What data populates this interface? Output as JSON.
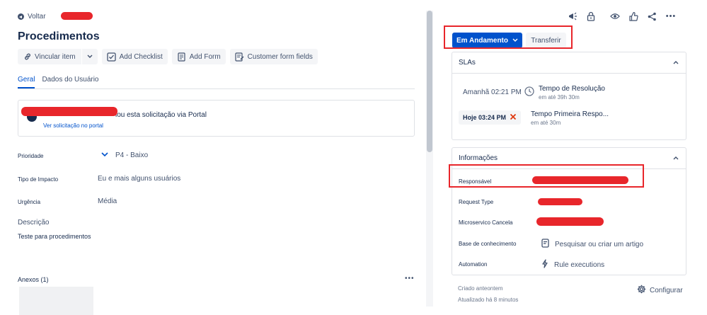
{
  "header": {
    "back_label": "Voltar",
    "title": "Procedimentos"
  },
  "toolbar": {
    "link_issue_label": "Vincular item",
    "add_checklist_label": "Add Checklist",
    "add_form_label": "Add Form",
    "customer_form_fields_label": "Customer form fields"
  },
  "tabs": [
    {
      "label": "Geral",
      "active": true
    },
    {
      "label": "Dados do Usuário",
      "active": false
    }
  ],
  "activity": {
    "message": "iou esta solicitação via Portal",
    "link": "Ver solicitação no portal"
  },
  "fields": {
    "priority_label": "Prioridade",
    "priority_value": "P4 - Baixo",
    "impact_label": "Tipo de Impacto",
    "impact_value": "Eu e mais alguns usuários",
    "urgency_label": "Urgência",
    "urgency_value": "Média",
    "description_label": "Descrição",
    "description_value": "Teste para procedimentos",
    "attachments_label": "Anexos (1)"
  },
  "actions": {
    "status_label": "Em Andamento",
    "transfer_label": "Transferir"
  },
  "slas": {
    "heading": "SLAs",
    "items": [
      {
        "time": "Amanhã 02:21 PM",
        "goal": "Tempo de Resolução",
        "remaining": "em até 39h 30m",
        "icon": "clock-icon"
      },
      {
        "time": "Hoje 03:24 PM",
        "goal": "Tempo Primeira Respo...",
        "remaining": "em até 30m",
        "icon": "close-icon"
      }
    ]
  },
  "info": {
    "heading": "Informações",
    "assignee_label": "Responsável",
    "request_type_label": "Request Type",
    "microservice_label": "Microservico Cancela",
    "knowledge_label": "Base de conhecimento",
    "knowledge_value": "Pesquisar ou criar um artigo",
    "automation_label": "Automation",
    "automation_value": "Rule executions"
  },
  "meta": {
    "created": "Criado anteontem",
    "updated": "Atualizado há 8 minutos",
    "configure_label": "Configurar"
  },
  "colors": {
    "primary": "#0052cc",
    "redaction": "#e8262b",
    "text": "#172b4d",
    "subtle": "#42526e"
  }
}
